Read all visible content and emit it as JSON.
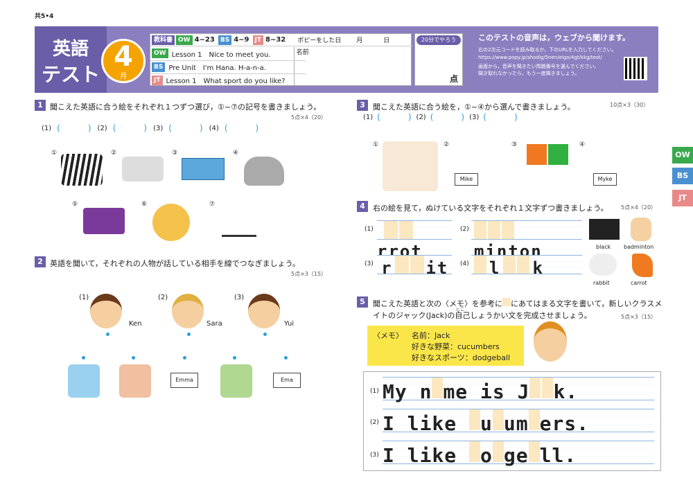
{
  "code": "共5•4",
  "header": {
    "subject": "英語",
    "test": "テスト",
    "month_num": "4",
    "month_unit": "月",
    "textbook_label": "教科書",
    "ow_tag": "OW",
    "ow_range": "4~23",
    "bs_tag": "BS",
    "bs_range": "4~9",
    "jt_tag": "JT",
    "jt_range": "8~32",
    "date_label": "ポピーをした日",
    "month_label": "月",
    "day_label": "日",
    "name_label": "名前",
    "ow_lesson": "Lesson 1　Nice to meet you.",
    "bs_lesson": "Pre Unit　I'm Hana.  H-a-n-a.",
    "jt_lesson": "Lesson 1　What sport do you like?",
    "time_label": "20分でやろう",
    "score_unit": "点",
    "audio_title": "このテストの音声は，ウェブから聞けます。",
    "audio_1": "右の2次元コードを読み取るか，下のURLを入力してください。",
    "audio_url": "https://www.popy.jp/shodig/5nen/eigo/4gt/kkg/test/",
    "audio_2": "画面から，音声を聞きたい問題番号を選んでください。",
    "audio_3": "聞き取れなかったら，もう一度聞きましょう。"
  },
  "tabs": {
    "ow": "OW",
    "bs": "BS",
    "jt": "JT"
  },
  "q1": {
    "num": "1",
    "text": "聞こえた英語に合う絵をそれぞれ１つずつ選び，①~⑦の記号を書きましょう。",
    "pts": "5点×4（20）",
    "answers": [
      "(1)",
      "(2)",
      "(3)",
      "(4)"
    ],
    "pic_labels": [
      "①",
      "②",
      "③",
      "④",
      "⑤",
      "⑥",
      "⑦"
    ]
  },
  "q2": {
    "num": "2",
    "text": "英語を聞いて，それぞれの人物が話している相手を線でつなぎましょう。",
    "pts": "5点×3（15）",
    "people": [
      {
        "n": "(1)",
        "name": "Ken"
      },
      {
        "n": "(2)",
        "name": "Sara"
      },
      {
        "n": "(3)",
        "name": "Yui"
      }
    ],
    "cards": [
      "Emma",
      "Ema"
    ]
  },
  "q3": {
    "num": "3",
    "text": "聞こえた英語に合う絵を，①~④から選んで書きましょう。",
    "pts": "10点×3（30）",
    "answers": [
      "(1)",
      "(2)",
      "(3)"
    ],
    "pic_labels": [
      "①",
      "②",
      "③",
      "④"
    ],
    "cards": [
      "Mike",
      "Myke"
    ]
  },
  "q4": {
    "num": "4",
    "text": "右の絵を見て，ぬけている文字をそれぞれ１文字ずつ書きましょう。",
    "pts": "5点×4（20）",
    "items": [
      {
        "n": "(1)",
        "word": "rrot"
      },
      {
        "n": "(2)",
        "word": "minton"
      },
      {
        "n": "(3)",
        "word_a": "r",
        "word_b": "it"
      },
      {
        "n": "(4)",
        "word_a": "l",
        "word_b": "k"
      }
    ],
    "pics": [
      "black",
      "badminton",
      "rabbit",
      "carrot"
    ]
  },
  "q5": {
    "num": "5",
    "text_1": "聞こえた英語と次の〈メモ〉を参考に",
    "text_2": "にあてはまる文字を書いて，新しいクラスメ",
    "text_3": "イトのジャック(Jack)の自己しょうかい文を完成させましょう。",
    "ruby": "じこ",
    "pts": "5点×3（15）",
    "memo_label": "〈メモ〉",
    "memo_name": "名前：Jack",
    "memo_veg": "好きな野菜：cucumbers",
    "memo_sport": "好きなスポーツ：dodgeball",
    "lines": [
      {
        "n": "(1)",
        "parts": [
          "My n",
          "me is J",
          "k."
        ]
      },
      {
        "n": "(2)",
        "parts": [
          "I like ",
          "u",
          "um",
          "ers."
        ]
      },
      {
        "n": "(3)",
        "parts": [
          "I like ",
          "o",
          "ge",
          "ll."
        ]
      }
    ]
  }
}
